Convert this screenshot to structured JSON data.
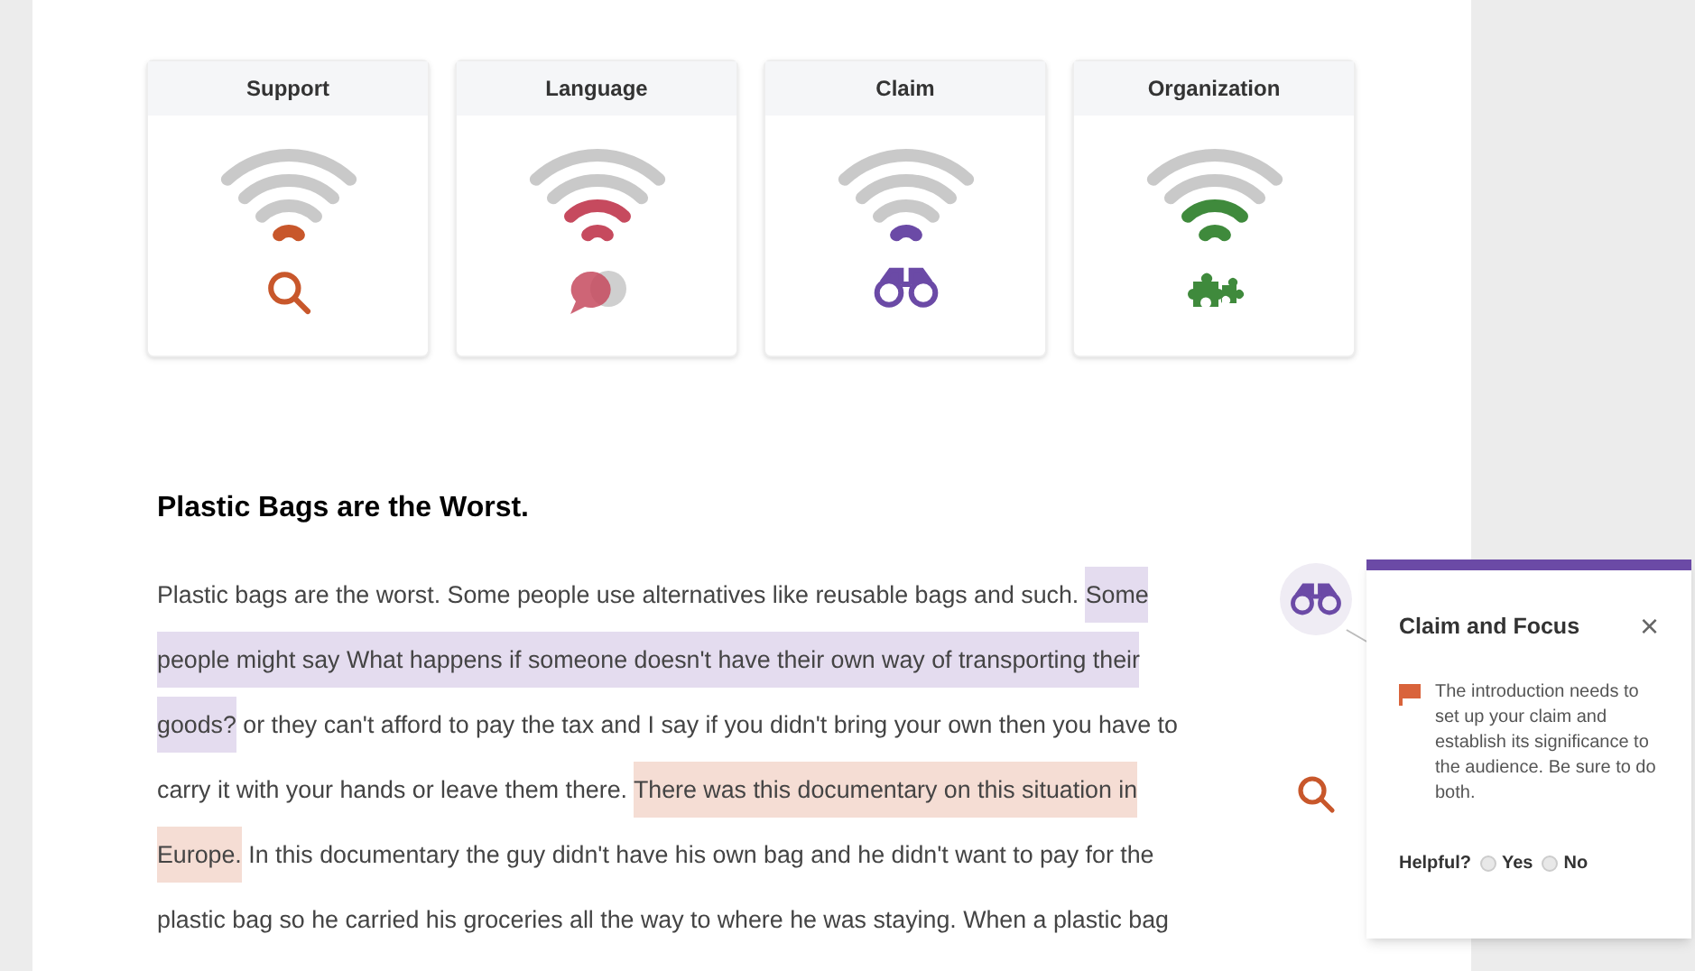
{
  "cards": [
    {
      "label": "Support",
      "level": 0.25,
      "color": "#c8572b"
    },
    {
      "label": "Language",
      "level": 0.5,
      "color": "#c64a5e"
    },
    {
      "label": "Claim",
      "level": 0.25,
      "color": "#6b4aa6"
    },
    {
      "label": "Organization",
      "level": 0.5,
      "color": "#3f8a3c"
    }
  ],
  "essay": {
    "title": "Plastic Bags are the Worst.",
    "segments": [
      {
        "text": "Plastic bags are the worst. Some people use alternatives like reusable bags and such. "
      },
      {
        "text": "Some people might say What happens if someone doesn't have their own way of transporting their goods?",
        "color": "#e4dcef"
      },
      {
        "text": " or they can't afford to pay the tax and I say if you didn't bring your own then you have to carry it with your hands or leave them there. "
      },
      {
        "text": "There was this documentary on this situation in Europe.",
        "color": "#f5ddd4"
      },
      {
        "text": " In this documentary the guy didn't have his own bag and he didn't want to pay for the plastic bag so he carried his groceries all the way to where he was staying. When a plastic bag"
      }
    ]
  },
  "markers": [
    {
      "kind": "claim",
      "selected": true
    },
    {
      "kind": "support",
      "selected": false
    }
  ],
  "popup": {
    "title": "Claim and Focus",
    "close": "×",
    "message": "The introduction needs to set up your claim and establish its significance to the audience. Be sure to do both.",
    "helpful_label": "Helpful?",
    "options": [
      {
        "label": "Yes",
        "selected": false
      },
      {
        "label": "No",
        "selected": false
      }
    ]
  }
}
